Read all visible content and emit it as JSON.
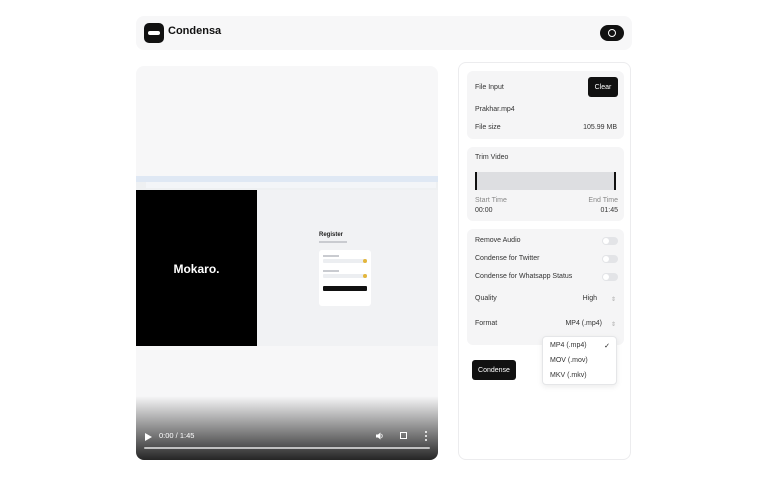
{
  "app": {
    "title": "Condensa"
  },
  "header": {
    "github_icon": "github-icon",
    "logo_icon": "logo-icon"
  },
  "video": {
    "time": "0:00 / 1:45",
    "progress": 0,
    "frame": {
      "brand": "Mokaro.",
      "form_title": "Register"
    }
  },
  "panel": {
    "file_input": {
      "label": "File Input",
      "clear_label": "Clear",
      "file_name": "Prakhar.mp4",
      "size_label": "File size",
      "size_value": "105.99 MB"
    },
    "trim": {
      "label": "Trim Video",
      "start_label": "Start Time",
      "start_value": "00:00",
      "end_label": "End Time",
      "end_value": "01:45"
    },
    "options": {
      "remove_audio": "Remove Audio",
      "twitter": "Condense for Twitter",
      "whatsapp": "Condense for Whatsapp Status",
      "quality_label": "Quality",
      "quality_value": "High",
      "format_label": "Format",
      "format_value": "MP4 (.mp4)"
    },
    "dropdown": [
      "MP4 (.mp4)",
      "MOV (.mov)",
      "MKV (.mkv)"
    ],
    "dropdown_check": "✓",
    "condense_label": "Condense"
  },
  "colors": {
    "accent": "#111111",
    "panel_bg": "#f5f5f6",
    "card_bg": "#f7f7f8"
  }
}
